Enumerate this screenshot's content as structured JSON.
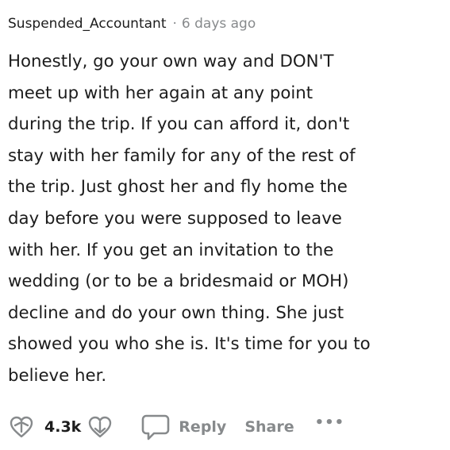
{
  "comment": {
    "username": "Suspended_Accountant",
    "separator": "·",
    "time": "6 days ago",
    "lines": [
      "Honestly, go your own way and DON'T",
      "meet up with her again at any point",
      "during the trip. If you can afford it, don't",
      "stay with her family for any of the rest of",
      "the trip. Just ghost her and fly home the",
      "day before you were supposed to leave",
      "with her. If you get an invitation to the",
      "wedding (or to be a bridesmaid or MOH)",
      "decline and do your own thing. She just",
      "showed you who she is. It's time for you to",
      "believe her."
    ]
  },
  "actions": {
    "upvote_icon": "upvote-icon",
    "vote_count": "4.3k",
    "downvote_icon": "downvote-icon",
    "reply_icon": "comment-bubble-icon",
    "reply_label": "Reply",
    "share_label": "Share",
    "more_label": "•••"
  },
  "colors": {
    "text": "#1c1c1c",
    "muted": "#878a8c",
    "background": "#ffffff"
  }
}
